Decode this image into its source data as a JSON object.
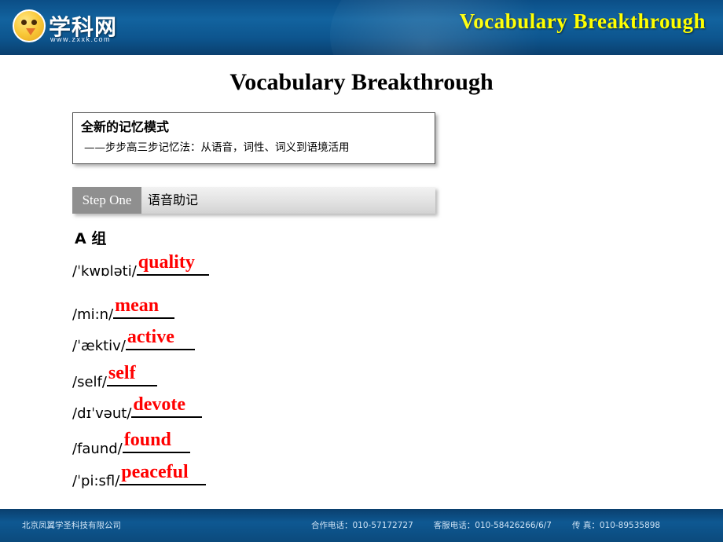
{
  "header": {
    "banner_title": "Vocabulary Breakthrough",
    "banner_title_color": "#ffff00",
    "logo_text": "学科网",
    "logo_url": "www.zxxk.com",
    "logo_icon": "bird-mascot-icon"
  },
  "slide": {
    "title": "Vocabulary Breakthrough",
    "mode_box": {
      "title": "全新的记忆模式",
      "subtitle": "——步步高三步记忆法：从语音，词性、词义到语境活用"
    },
    "step_bar": {
      "label": "Step One",
      "text": "语音助记"
    },
    "group_label": "A 组",
    "items": [
      {
        "phonetic": "/ˈkwɒləti/",
        "answer": "quality",
        "blank_width": 92
      },
      {
        "phonetic": "/mi:n/",
        "answer": "mean",
        "blank_width": 78
      },
      {
        "phonetic": "/ˈæktiv/",
        "answer": "active",
        "blank_width": 88
      },
      {
        "phonetic": "/self/",
        "answer": "self",
        "blank_width": 64
      },
      {
        "phonetic": "/dɪˈvəut/",
        "answer": "devote",
        "blank_width": 90
      },
      {
        "phonetic": "/faund/",
        "answer": "found",
        "blank_width": 86
      },
      {
        "phonetic": "/ˈpi:sfl/",
        "answer": "peaceful",
        "blank_width": 110
      }
    ]
  },
  "footer": {
    "left": "北京凤翼学圣科技有限公司",
    "cells": [
      "合作电话：010-57172727",
      "客服电话：010-58426266/6/7",
      "传  真：010-89535898"
    ]
  }
}
